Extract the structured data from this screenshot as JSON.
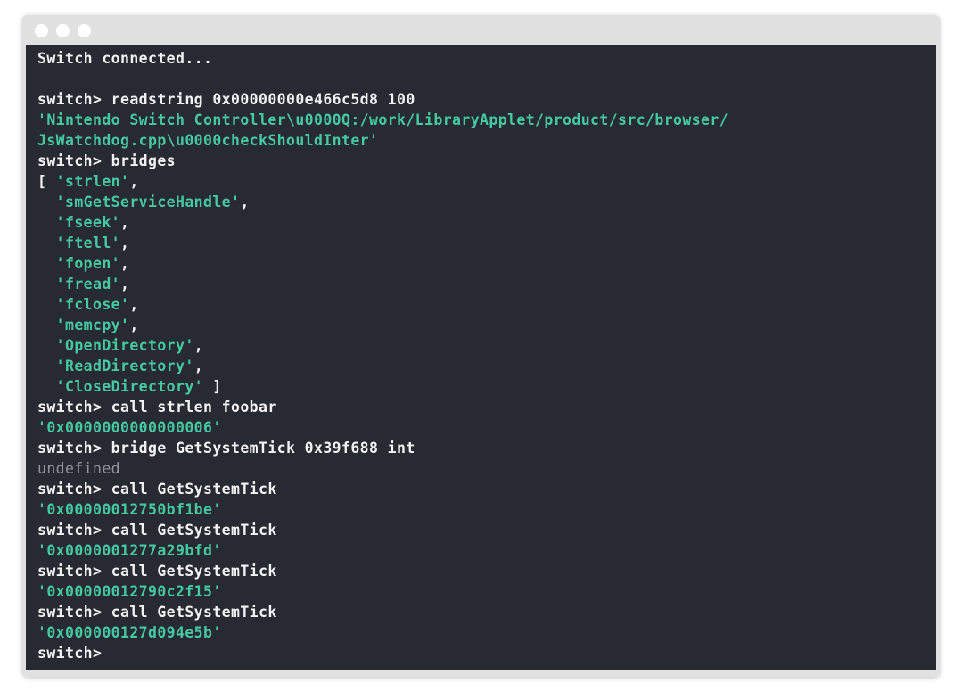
{
  "window": {
    "colors": {
      "frame": "#e1e1e1",
      "terminal_bg": "#282a33",
      "text": "#f2f2f2",
      "string": "#45c9a1",
      "undefined": "#8f9599"
    }
  },
  "terminal": {
    "lines": [
      {
        "type": "out",
        "text": "Switch connected..."
      },
      {
        "type": "blank",
        "text": ""
      },
      {
        "type": "cmd",
        "text": "switch> readstring 0x00000000e466c5d8 100"
      },
      {
        "type": "str",
        "text": "'Nintendo Switch Controller\\u0000Q:/work/LibraryApplet/product/src/browser/"
      },
      {
        "type": "str",
        "text": "JsWatchdog.cpp\\u0000checkShouldInter'"
      },
      {
        "type": "cmd",
        "text": "switch> bridges"
      },
      {
        "type": "mixed",
        "prefix": "[ ",
        "value": "'strlen'",
        "suffix": ","
      },
      {
        "type": "mixed",
        "prefix": "  ",
        "value": "'smGetServiceHandle'",
        "suffix": ","
      },
      {
        "type": "mixed",
        "prefix": "  ",
        "value": "'fseek'",
        "suffix": ","
      },
      {
        "type": "mixed",
        "prefix": "  ",
        "value": "'ftell'",
        "suffix": ","
      },
      {
        "type": "mixed",
        "prefix": "  ",
        "value": "'fopen'",
        "suffix": ","
      },
      {
        "type": "mixed",
        "prefix": "  ",
        "value": "'fread'",
        "suffix": ","
      },
      {
        "type": "mixed",
        "prefix": "  ",
        "value": "'fclose'",
        "suffix": ","
      },
      {
        "type": "mixed",
        "prefix": "  ",
        "value": "'memcpy'",
        "suffix": ","
      },
      {
        "type": "mixed",
        "prefix": "  ",
        "value": "'OpenDirectory'",
        "suffix": ","
      },
      {
        "type": "mixed",
        "prefix": "  ",
        "value": "'ReadDirectory'",
        "suffix": ","
      },
      {
        "type": "mixed",
        "prefix": "  ",
        "value": "'CloseDirectory'",
        "suffix": " ]"
      },
      {
        "type": "cmd",
        "text": "switch> call strlen foobar"
      },
      {
        "type": "str",
        "text": "'0x0000000000000006'"
      },
      {
        "type": "cmd",
        "text": "switch> bridge GetSystemTick 0x39f688 int"
      },
      {
        "type": "undef",
        "text": "undefined"
      },
      {
        "type": "cmd",
        "text": "switch> call GetSystemTick"
      },
      {
        "type": "str",
        "text": "'0x00000012750bf1be'"
      },
      {
        "type": "cmd",
        "text": "switch> call GetSystemTick"
      },
      {
        "type": "str",
        "text": "'0x0000001277a29bfd'"
      },
      {
        "type": "cmd",
        "text": "switch> call GetSystemTick"
      },
      {
        "type": "str",
        "text": "'0x00000012790c2f15'"
      },
      {
        "type": "cmd",
        "text": "switch> call GetSystemTick"
      },
      {
        "type": "str",
        "text": "'0x000000127d094e5b'"
      },
      {
        "type": "cmd",
        "text": "switch>"
      }
    ]
  }
}
